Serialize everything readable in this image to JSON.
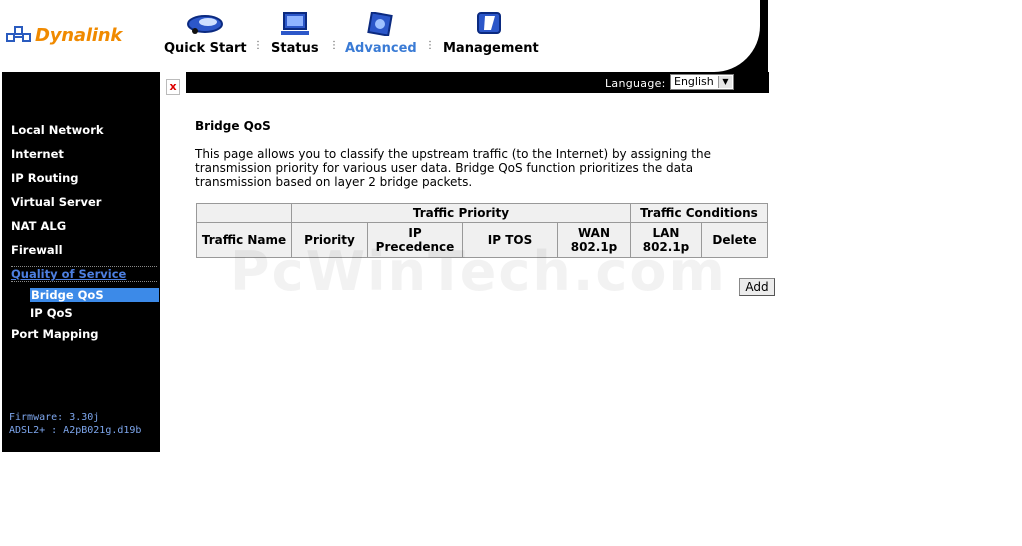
{
  "brand": {
    "name": "Dynalink",
    "color": "#f08a00"
  },
  "nav": [
    {
      "label": "Quick Start",
      "icon": "car-icon"
    },
    {
      "label": "Status",
      "icon": "monitor-icon"
    },
    {
      "label": "Advanced",
      "icon": "chip-icon",
      "active": true
    },
    {
      "label": "Management",
      "icon": "folder-icon"
    }
  ],
  "language": {
    "label": "Language:",
    "selected": "English"
  },
  "sidebar": {
    "items": [
      "Local Network",
      "Internet",
      "IP Routing",
      "Virtual Server",
      "NAT ALG",
      "Firewall",
      "Quality of Service"
    ],
    "subitems": [
      "Bridge QoS",
      "IP QoS"
    ],
    "after": "Port Mapping",
    "firmware_label": "Firmware: 3.30j",
    "adsl_label": "ADSL2+ : A2pB021g.d19b"
  },
  "main": {
    "title": "Bridge QoS",
    "description": "This page allows you to classify the upstream traffic (to the Internet) by assigning the transmission priority for various user data. Bridge QoS function prioritizes the data transmission based on layer 2 bridge packets.",
    "table": {
      "group1": "Traffic Priority",
      "group2": "Traffic Conditions",
      "columns": [
        "Traffic Name",
        "Priority",
        "IP Precedence",
        "IP TOS",
        "WAN 802.1p",
        "LAN 802.1p",
        "Delete"
      ]
    },
    "add_label": "Add"
  },
  "watermark": "PcWinTech.com",
  "colors": {
    "active_nav": "#3a7bd5",
    "sidebar_bg": "#000000",
    "sidebar_active": "#3c8ae8"
  }
}
